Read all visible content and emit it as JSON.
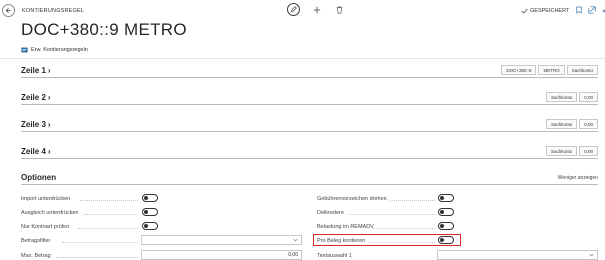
{
  "header": {
    "caption": "KONTIERUNGSREGEL",
    "title": "DOC+380::9 METRO",
    "saved_label": "GESPEICHERT"
  },
  "action_bar": {
    "label": "Erw. Kontierungsregeln"
  },
  "sections": [
    {
      "title": "Zeile 1",
      "chips": [
        "DOC+380::9",
        "METRO",
        "Sachkonto"
      ]
    },
    {
      "title": "Zeile 2",
      "chips": [
        "Sachkonto",
        "0,00"
      ]
    },
    {
      "title": "Zeile 3",
      "chips": [
        "Sachkonto",
        "0,00"
      ]
    },
    {
      "title": "Zeile 4",
      "chips": [
        "Sachkonto",
        "0,00"
      ]
    }
  ],
  "options": {
    "title": "Optionen",
    "less_link": "Weniger anzeigen",
    "left": [
      {
        "label": "Import unterdrücken"
      },
      {
        "label": "Ausgleich unterdrücken"
      },
      {
        "label": "Nur Kontoart prüfen"
      },
      {
        "label": "Betragsfilter",
        "value": ""
      },
      {
        "label": "Max. Betrag",
        "value": "0,00"
      }
    ],
    "right": [
      {
        "label": "Gebührenvorzeichen drehen"
      },
      {
        "label": "Delkredere"
      },
      {
        "label": "Belastung im REMADV"
      },
      {
        "label": "Pro Beleg kontieren"
      },
      {
        "label": "Textauswahl 1",
        "value": ""
      }
    ]
  },
  "colors": {
    "highlight": "#d22d2d"
  }
}
